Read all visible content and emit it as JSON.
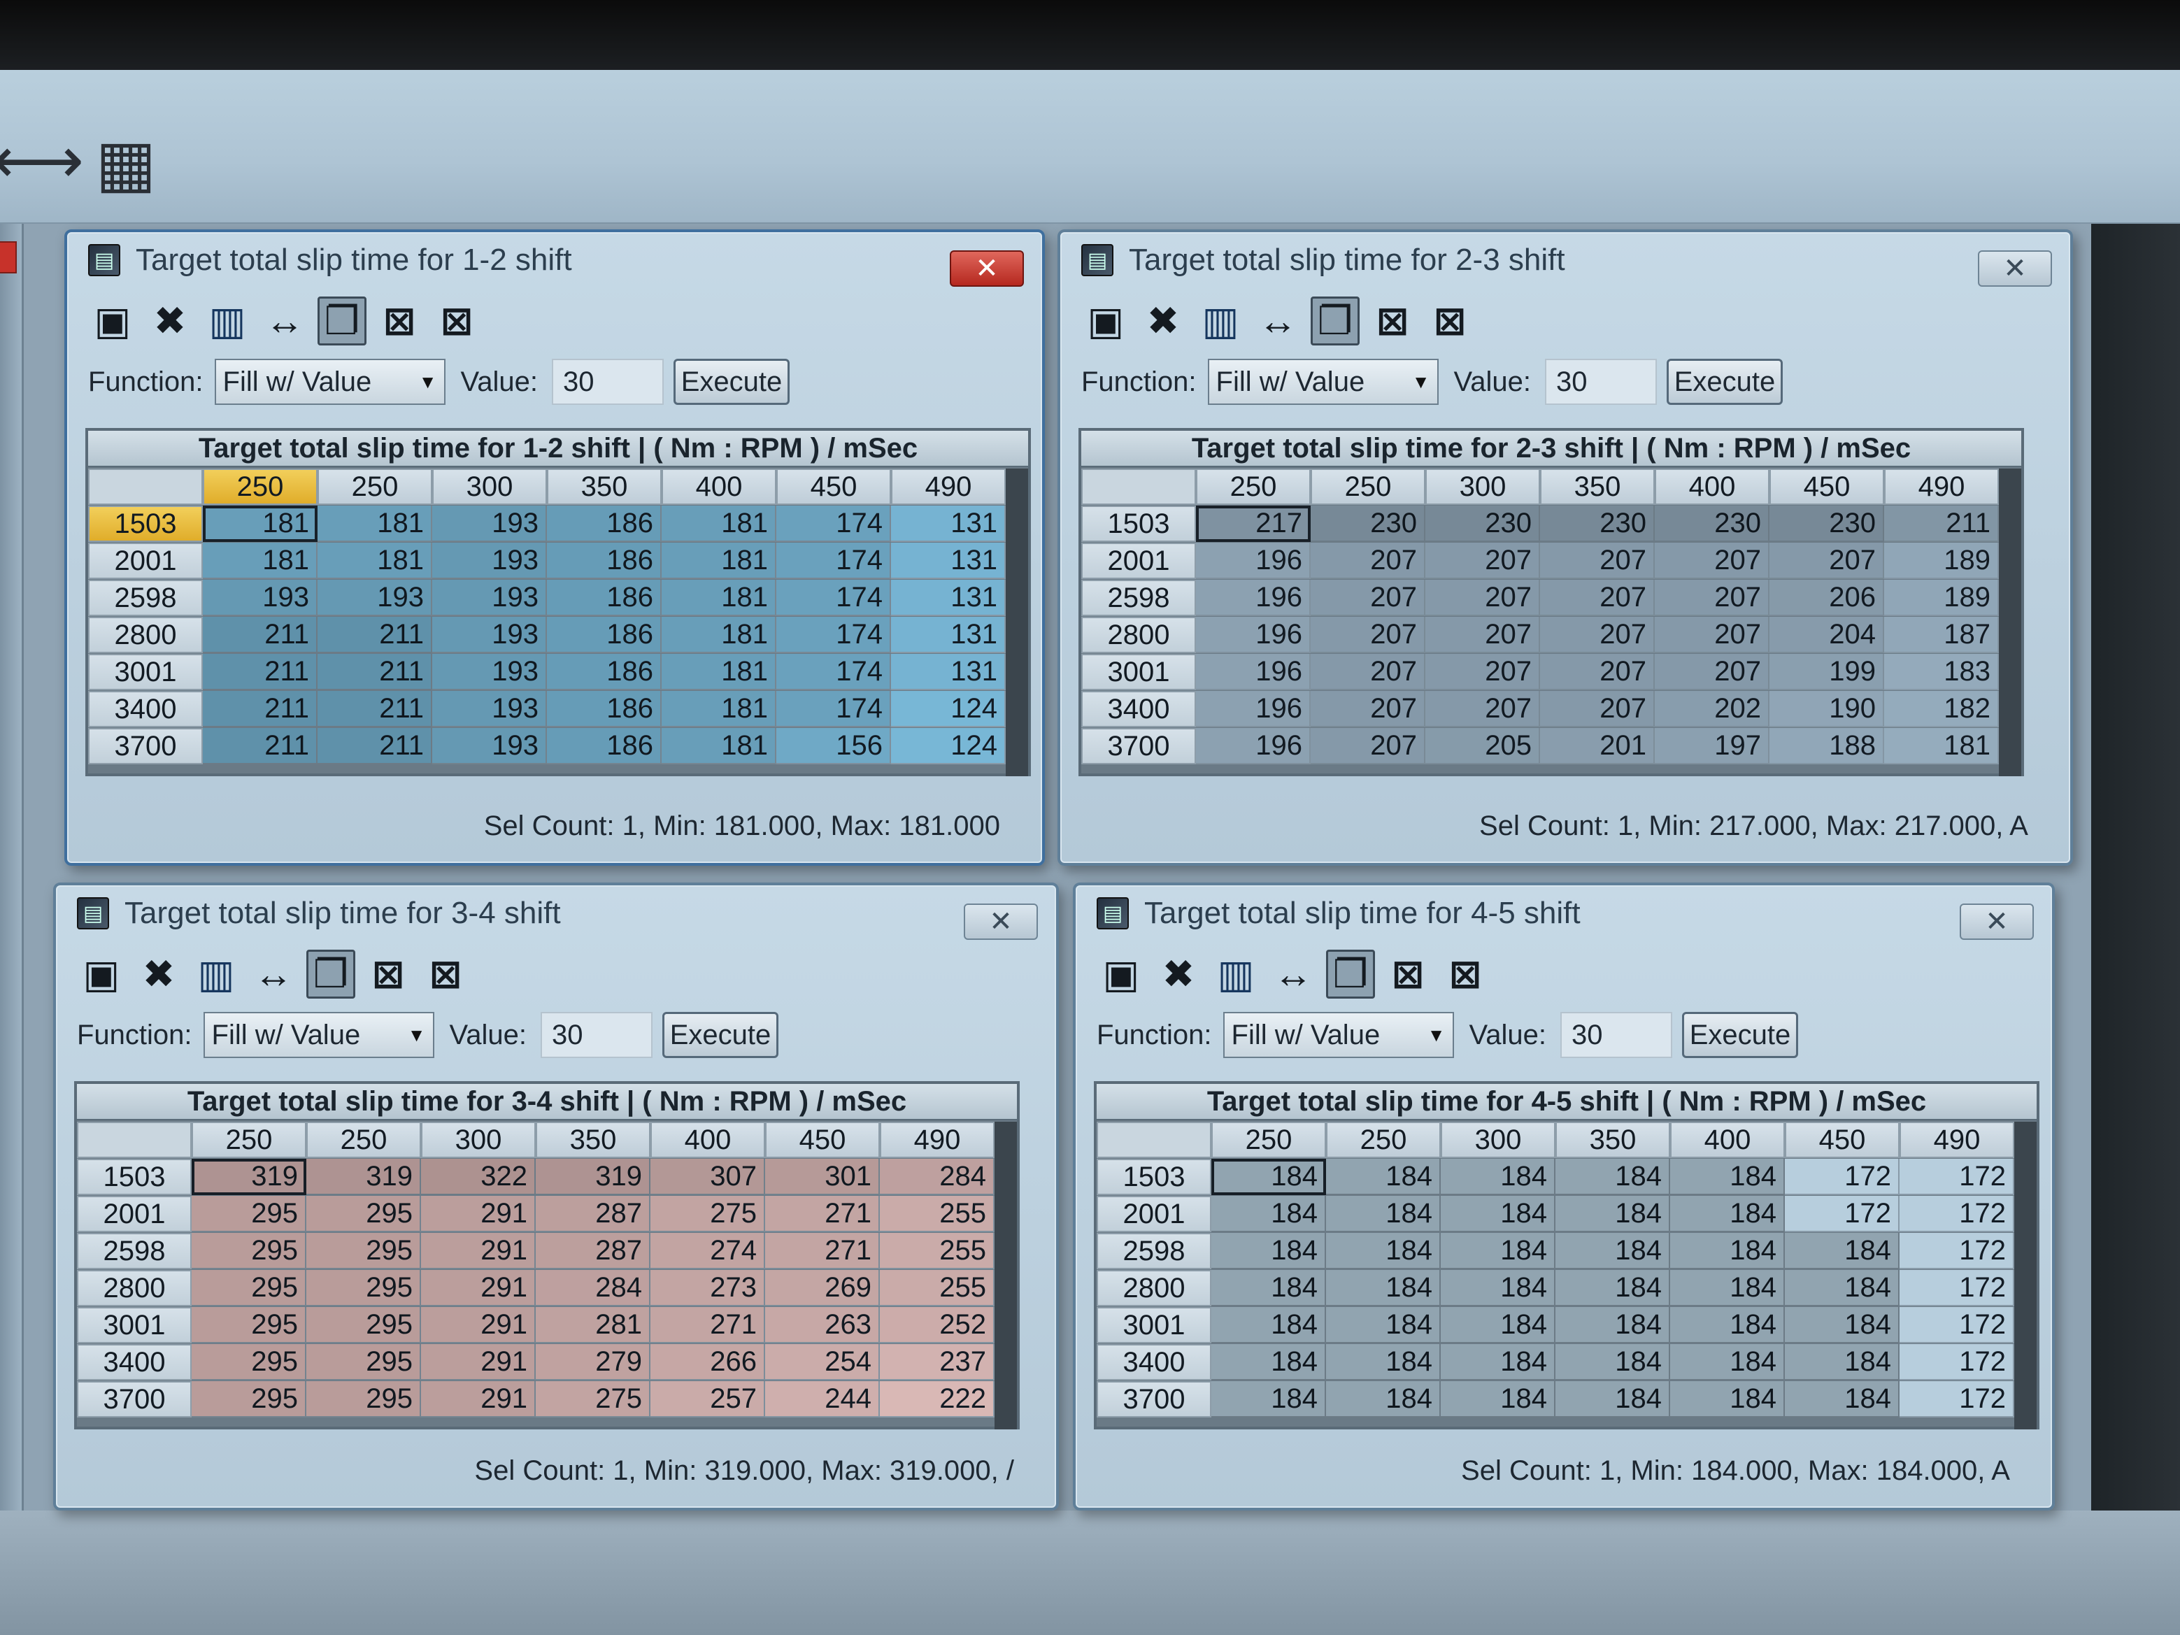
{
  "app_toolbar": {
    "buttons": [
      {
        "name": "swap-arrows-icon",
        "glyph": "⟷"
      },
      {
        "name": "calculator-icon",
        "glyph": "▦"
      }
    ]
  },
  "toolbar_icons": [
    {
      "name": "save-icon",
      "glyph": "▣"
    },
    {
      "name": "delete-icon",
      "glyph": "✖"
    },
    {
      "name": "graph-icon",
      "glyph": "▥"
    },
    {
      "name": "swap-icon",
      "glyph": "↔"
    },
    {
      "name": "copy-icon",
      "glyph": "❐"
    },
    {
      "name": "interpolate-icon",
      "glyph": "⊠"
    },
    {
      "name": "smooth-icon",
      "glyph": "⊠"
    }
  ],
  "function_row": {
    "function_label": "Function:",
    "function_value": "Fill w/ Value",
    "value_label": "Value:",
    "value": "30",
    "execute_label": "Execute"
  },
  "windows": [
    {
      "title": "Target total slip time for 1-2 shift",
      "grid_caption": "Target total slip time for 1-2 shift |  ( Nm : RPM ) / mSec",
      "columns": [
        "250",
        "250",
        "300",
        "350",
        "400",
        "450",
        "490"
      ],
      "rows": [
        "1503",
        "2001",
        "2598",
        "2800",
        "3001",
        "3400",
        "3700"
      ],
      "cells": [
        [
          "181",
          "181",
          "193",
          "186",
          "181",
          "174",
          "131"
        ],
        [
          "181",
          "181",
          "193",
          "186",
          "181",
          "174",
          "131"
        ],
        [
          "193",
          "193",
          "193",
          "186",
          "181",
          "174",
          "131"
        ],
        [
          "211",
          "211",
          "193",
          "186",
          "181",
          "174",
          "131"
        ],
        [
          "211",
          "211",
          "193",
          "186",
          "181",
          "174",
          "131"
        ],
        [
          "211",
          "211",
          "193",
          "186",
          "181",
          "174",
          "124"
        ],
        [
          "211",
          "211",
          "193",
          "186",
          "181",
          "156",
          "124"
        ]
      ],
      "status": "Sel Count: 1, Min: 181.000, Max: 181.000",
      "tint": "#6fa9c6"
    },
    {
      "title": "Target total slip time for 2-3 shift",
      "grid_caption": "Target total slip time for 2-3 shift |  ( Nm : RPM ) / mSec",
      "columns": [
        "250",
        "250",
        "300",
        "350",
        "400",
        "450",
        "490"
      ],
      "rows": [
        "1503",
        "2001",
        "2598",
        "2800",
        "3001",
        "3400",
        "3700"
      ],
      "cells": [
        [
          "217",
          "230",
          "230",
          "230",
          "230",
          "230",
          "211"
        ],
        [
          "196",
          "207",
          "207",
          "207",
          "207",
          "207",
          "189"
        ],
        [
          "196",
          "207",
          "207",
          "207",
          "207",
          "206",
          "189"
        ],
        [
          "196",
          "207",
          "207",
          "207",
          "207",
          "204",
          "187"
        ],
        [
          "196",
          "207",
          "207",
          "207",
          "207",
          "199",
          "183"
        ],
        [
          "196",
          "207",
          "207",
          "207",
          "202",
          "190",
          "182"
        ],
        [
          "196",
          "207",
          "205",
          "201",
          "197",
          "188",
          "181"
        ]
      ],
      "status": "Sel Count: 1, Min: 217.000, Max: 217.000, A",
      "tint": "#8a9faf"
    },
    {
      "title": "Target total slip time for 3-4 shift",
      "grid_caption": "Target total slip time for 3-4 shift |  ( Nm : RPM ) / mSec",
      "columns": [
        "250",
        "250",
        "300",
        "350",
        "400",
        "450",
        "490"
      ],
      "rows": [
        "1503",
        "2001",
        "2598",
        "2800",
        "3001",
        "3400",
        "3700"
      ],
      "cells": [
        [
          "319",
          "319",
          "322",
          "319",
          "307",
          "301",
          "284"
        ],
        [
          "295",
          "295",
          "291",
          "287",
          "275",
          "271",
          "255"
        ],
        [
          "295",
          "295",
          "291",
          "287",
          "274",
          "271",
          "255"
        ],
        [
          "295",
          "295",
          "291",
          "284",
          "273",
          "269",
          "255"
        ],
        [
          "295",
          "295",
          "291",
          "281",
          "271",
          "263",
          "252"
        ],
        [
          "295",
          "295",
          "291",
          "279",
          "266",
          "254",
          "237"
        ],
        [
          "295",
          "295",
          "291",
          "275",
          "257",
          "244",
          "222"
        ]
      ],
      "status": "Sel Count: 1, Min: 319.000, Max: 319.000, /",
      "tint": "#c9aaa8"
    },
    {
      "title": "Target total slip time for 4-5 shift",
      "grid_caption": "Target total slip time for 4-5 shift |  ( Nm : RPM ) / mSec",
      "columns": [
        "250",
        "250",
        "300",
        "350",
        "400",
        "450",
        "490"
      ],
      "rows": [
        "1503",
        "2001",
        "2598",
        "2800",
        "3001",
        "3400",
        "3700"
      ],
      "cells": [
        [
          "184",
          "184",
          "184",
          "184",
          "184",
          "172",
          "172"
        ],
        [
          "184",
          "184",
          "184",
          "184",
          "184",
          "172",
          "172"
        ],
        [
          "184",
          "184",
          "184",
          "184",
          "184",
          "184",
          "172"
        ],
        [
          "184",
          "184",
          "184",
          "184",
          "184",
          "184",
          "172"
        ],
        [
          "184",
          "184",
          "184",
          "184",
          "184",
          "184",
          "172"
        ],
        [
          "184",
          "184",
          "184",
          "184",
          "184",
          "184",
          "172"
        ],
        [
          "184",
          "184",
          "184",
          "184",
          "184",
          "184",
          "172"
        ]
      ],
      "status": "Sel Count: 1, Min: 184.000, Max: 184.000, A",
      "tint": "#a9bfcd"
    }
  ],
  "colors": {
    "selected_header": "#e0ad2a",
    "active_close": "#b5281f"
  }
}
